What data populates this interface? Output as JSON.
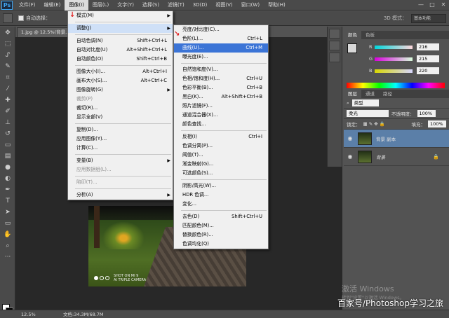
{
  "menubar": {
    "logo": "Ps",
    "items": [
      "文件(F)",
      "编辑(E)",
      "图像(I)",
      "图层(L)",
      "文字(Y)",
      "选择(S)",
      "滤镜(T)",
      "3D(D)",
      "视图(V)",
      "窗口(W)",
      "帮助(H)"
    ],
    "active_index": 2,
    "window_controls": [
      "—",
      "□",
      "✕"
    ]
  },
  "optionsbar": {
    "auto_select_label": "自动选择：",
    "mode_3d": "3D 模式：",
    "workspace": "基本功能"
  },
  "document": {
    "tab_title": "1.jpg @ 12.5%(背景..."
  },
  "photo": {
    "camera_line1": "SHOT ON MI 9",
    "camera_line2": "AI TRIPLE CAMERA"
  },
  "image_menu": {
    "items": [
      {
        "label": "模式(M)",
        "shortcut": "",
        "submenu": true,
        "disabled": false
      },
      {
        "sep": true
      },
      {
        "label": "调整(J)",
        "shortcut": "",
        "submenu": true,
        "disabled": false,
        "open": true
      },
      {
        "sep": true
      },
      {
        "label": "自动色调(N)",
        "shortcut": "Shift+Ctrl+L",
        "disabled": false
      },
      {
        "label": "自动对比度(U)",
        "shortcut": "Alt+Shift+Ctrl+L",
        "disabled": false
      },
      {
        "label": "自动颜色(O)",
        "shortcut": "Shift+Ctrl+B",
        "disabled": false
      },
      {
        "sep": true
      },
      {
        "label": "图像大小(I)...",
        "shortcut": "Alt+Ctrl+I",
        "disabled": false
      },
      {
        "label": "画布大小(S)...",
        "shortcut": "Alt+Ctrl+C",
        "disabled": false
      },
      {
        "label": "图像旋转(G)",
        "shortcut": "",
        "submenu": true,
        "disabled": false
      },
      {
        "label": "裁剪(P)",
        "shortcut": "",
        "disabled": true
      },
      {
        "label": "裁切(R)...",
        "shortcut": "",
        "disabled": false
      },
      {
        "label": "显示全部(V)",
        "shortcut": "",
        "disabled": false
      },
      {
        "sep": true
      },
      {
        "label": "复制(D)...",
        "shortcut": "",
        "disabled": false
      },
      {
        "label": "应用图像(Y)...",
        "shortcut": "",
        "disabled": false
      },
      {
        "label": "计算(C)...",
        "shortcut": "",
        "disabled": false
      },
      {
        "sep": true
      },
      {
        "label": "变量(B)",
        "shortcut": "",
        "submenu": true,
        "disabled": false
      },
      {
        "label": "应用数据组(L)...",
        "shortcut": "",
        "disabled": true
      },
      {
        "sep": true
      },
      {
        "label": "陷印(T)...",
        "shortcut": "",
        "disabled": true
      },
      {
        "sep": true
      },
      {
        "label": "分析(A)",
        "shortcut": "",
        "submenu": true,
        "disabled": false
      }
    ]
  },
  "adjust_menu": {
    "items": [
      {
        "label": "亮度/对比度(C)...",
        "shortcut": ""
      },
      {
        "label": "色阶(L)...",
        "shortcut": "Ctrl+L"
      },
      {
        "label": "曲线(U)...",
        "shortcut": "Ctrl+M",
        "highlight": true
      },
      {
        "label": "曝光度(E)...",
        "shortcut": ""
      },
      {
        "sep": true
      },
      {
        "label": "自然饱和度(V)...",
        "shortcut": ""
      },
      {
        "label": "色相/饱和度(H)...",
        "shortcut": "Ctrl+U"
      },
      {
        "label": "色彩平衡(B)...",
        "shortcut": "Ctrl+B"
      },
      {
        "label": "黑白(K)...",
        "shortcut": "Alt+Shift+Ctrl+B"
      },
      {
        "label": "照片滤镜(F)...",
        "shortcut": ""
      },
      {
        "label": "通道混合器(X)...",
        "shortcut": ""
      },
      {
        "label": "颜色查找...",
        "shortcut": ""
      },
      {
        "sep": true
      },
      {
        "label": "反相(I)",
        "shortcut": "Ctrl+I"
      },
      {
        "label": "色调分离(P)...",
        "shortcut": ""
      },
      {
        "label": "阈值(T)...",
        "shortcut": ""
      },
      {
        "label": "渐变映射(G)...",
        "shortcut": ""
      },
      {
        "label": "可选颜色(S)...",
        "shortcut": ""
      },
      {
        "sep": true
      },
      {
        "label": "阴影/高光(W)...",
        "shortcut": ""
      },
      {
        "label": "HDR 色调...",
        "shortcut": ""
      },
      {
        "label": "变化...",
        "shortcut": ""
      },
      {
        "sep": true
      },
      {
        "label": "去色(D)",
        "shortcut": "Shift+Ctrl+U"
      },
      {
        "label": "匹配颜色(M)...",
        "shortcut": ""
      },
      {
        "label": "替换颜色(R)...",
        "shortcut": ""
      },
      {
        "label": "色调均化(Q)",
        "shortcut": ""
      }
    ]
  },
  "color_panel": {
    "tabs": [
      "颜色",
      "色板"
    ],
    "sliders": [
      {
        "label": "R",
        "value": "216"
      },
      {
        "label": "G",
        "value": "215"
      },
      {
        "label": "B",
        "value": "220"
      }
    ]
  },
  "layers_panel": {
    "tabs": [
      "图层",
      "通道",
      "路径"
    ],
    "filter_label": "类型",
    "blend_mode": "柔光",
    "opacity_label": "不透明度：",
    "opacity_value": "100%",
    "lock_label": "锁定：",
    "fill_label": "填充：",
    "fill_value": "100%",
    "layers": [
      {
        "name": "背景 副本",
        "selected": true,
        "locked": false
      },
      {
        "name": "背景",
        "selected": false,
        "locked": true
      }
    ]
  },
  "overlay": {
    "win_activate": "激活 Windows",
    "win_activate_sub": "转到\"设置\"以激活 Windows。",
    "baidu": "百家号/Photoshop学习之旅"
  },
  "statusbar": {
    "zoom": "12.5%",
    "doc_info": "文档:34.3M/68.7M"
  }
}
